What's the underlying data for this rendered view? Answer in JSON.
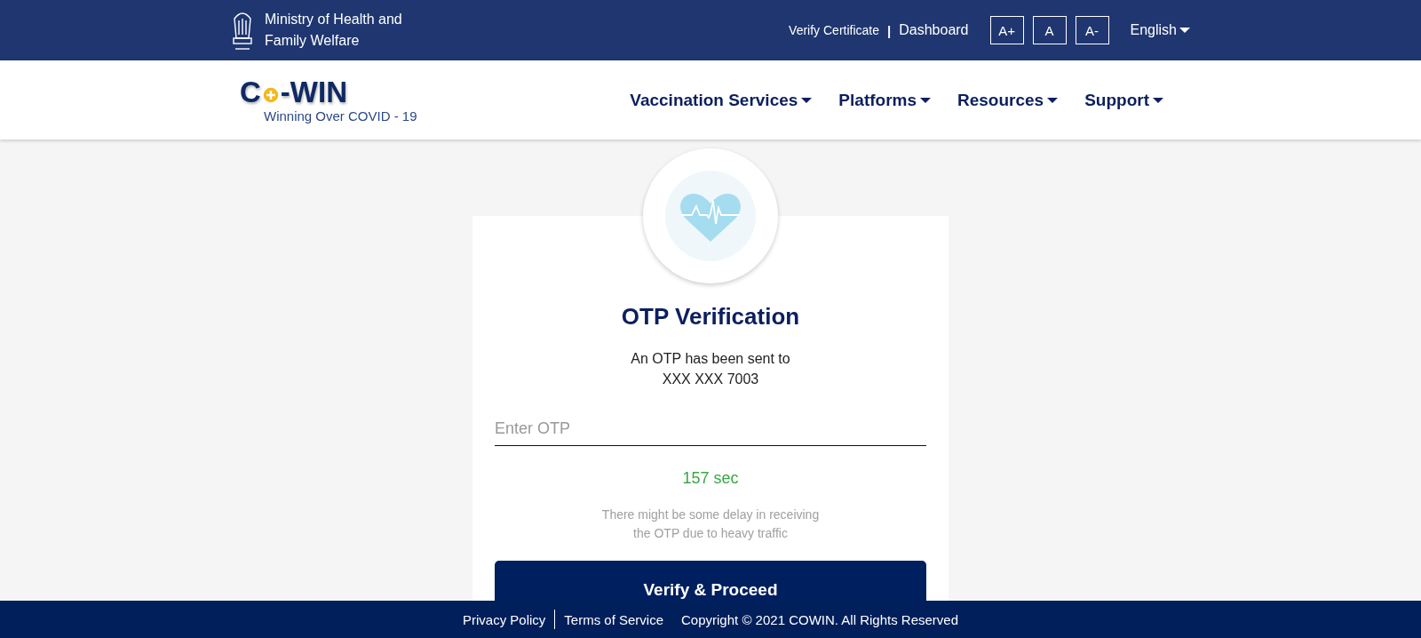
{
  "top_bar": {
    "ministry": "Ministry of Health and\nFamily Welfare",
    "links": [
      {
        "label": "Verify Certificate",
        "kind": "small"
      },
      {
        "label": "|",
        "kind": "separator"
      },
      {
        "label": "Dashboard",
        "kind": "large"
      }
    ],
    "font_size_buttons": [
      "A+",
      "A",
      "A-"
    ],
    "language": "English"
  },
  "nav": {
    "logo": {
      "before": "C",
      "after": "-WIN",
      "tagline": "Winning Over COVID - 19"
    },
    "menu": [
      "Vaccination Services",
      "Platforms",
      "Resources",
      "Support"
    ]
  },
  "card": {
    "title": "OTP Verification",
    "message": "An OTP has been sent to\nXXX XXX 7003",
    "otp_field": {
      "placeholder": "Enter OTP"
    },
    "timer": "157 sec",
    "note": "There might be some delay in receiving\nthe OTP due to heavy traffic",
    "button": "Verify & Proceed"
  },
  "footer": {
    "links": [
      "Privacy Policy",
      "Terms of Service"
    ],
    "copyright": "Copyright © 2021 COWIN. All Rights Reserved"
  }
}
